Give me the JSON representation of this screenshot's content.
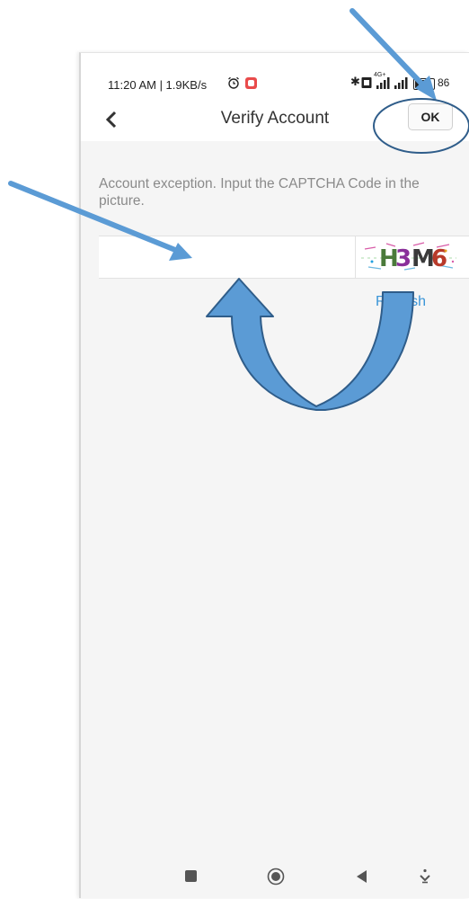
{
  "caption": "",
  "status_bar": {
    "time": "11:20 AM | 1.9KB/s",
    "battery": "86",
    "network": "4G+"
  },
  "header": {
    "title": "Verify Account",
    "ok_label": "OK"
  },
  "content": {
    "instruction": "Account exception. Input the CAPTCHA Code in the picture.",
    "captcha_value": "",
    "captcha_text": "H3M6",
    "refresh_label": "Refresh"
  },
  "colors": {
    "accent": "#3a95d8",
    "annotation_arrow": "#5b9bd5",
    "annotation_outline": "#2f5d8a"
  }
}
